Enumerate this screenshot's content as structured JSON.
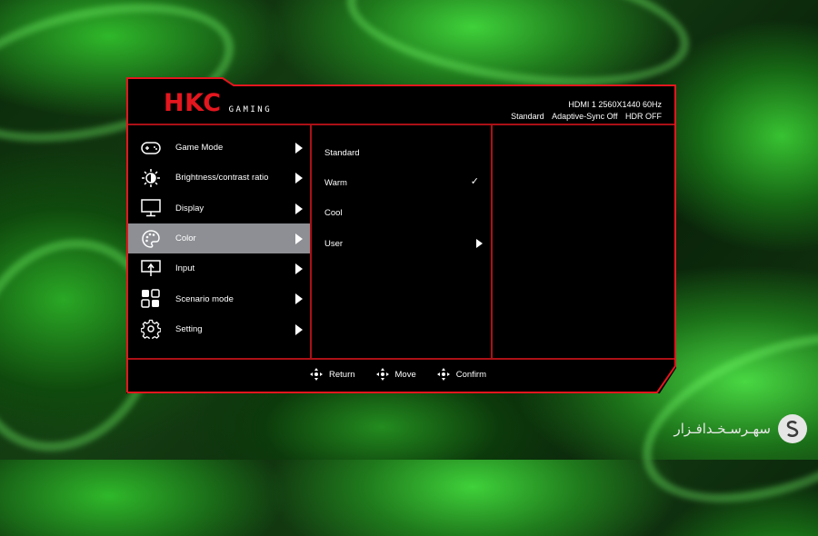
{
  "brand": {
    "logo": "HKC",
    "sub": "GAMING"
  },
  "status": {
    "input": "HDMI 1",
    "resolution": "2560X1440",
    "refresh": "60Hz",
    "preset": "Standard",
    "adaptive_sync": "Adaptive-Sync Off",
    "hdr": "HDR OFF"
  },
  "menu": {
    "items": [
      {
        "label": "Game Mode",
        "icon": "gamepad-icon"
      },
      {
        "label": "Brightness/contrast ratio",
        "icon": "brightness-icon"
      },
      {
        "label": "Display",
        "icon": "monitor-icon"
      },
      {
        "label": "Color",
        "icon": "palette-icon",
        "selected": true
      },
      {
        "label": "Input",
        "icon": "input-icon"
      },
      {
        "label": "Scenario mode",
        "icon": "scenario-icon"
      },
      {
        "label": "Setting",
        "icon": "gear-icon"
      }
    ]
  },
  "submenu": {
    "items": [
      {
        "label": "Standard"
      },
      {
        "label": "Warm",
        "checked": true,
        "check": "✓"
      },
      {
        "label": "Cool"
      },
      {
        "label": "User",
        "has_arrow": true
      }
    ]
  },
  "footer": {
    "return_label": "Return",
    "move_label": "Move",
    "confirm_label": "Confirm"
  },
  "watermark": {
    "text": "سهـرسـخـدافـزار"
  },
  "colors": {
    "accent_red": "#e4161e",
    "selected_bg": "#8d8f94",
    "osd_bg": "#000000"
  }
}
